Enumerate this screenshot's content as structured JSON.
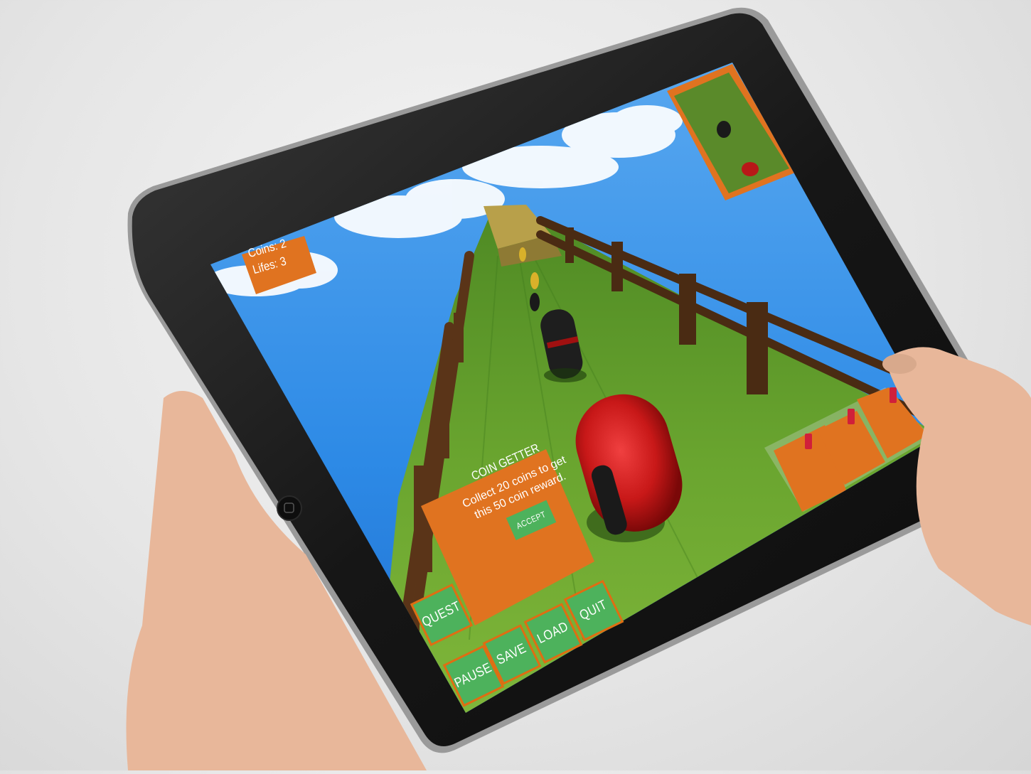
{
  "hud": {
    "coins_label": "Coins: 2",
    "lifes_label": "Lifes: 3"
  },
  "quest_panel": {
    "title": "COIN GETTER",
    "description": "Collect 20 coins to get this 50 coin reward.",
    "accept_label": "ACCEPT"
  },
  "menu": {
    "quest_label": "QUEST",
    "pause_label": "PAUSE",
    "save_label": "SAVE",
    "load_label": "LOAD",
    "quit_label": "QUIT"
  },
  "colors": {
    "accent_orange": "#e07320",
    "button_green": "#4db25c",
    "sky_blue": "#2f8ee6",
    "grass_green": "#6aa02e",
    "ball_red": "#c81818",
    "tablet_frame": "#141414"
  },
  "icons": [
    "minimap-icon",
    "health-cross-icon",
    "coin-icon"
  ]
}
